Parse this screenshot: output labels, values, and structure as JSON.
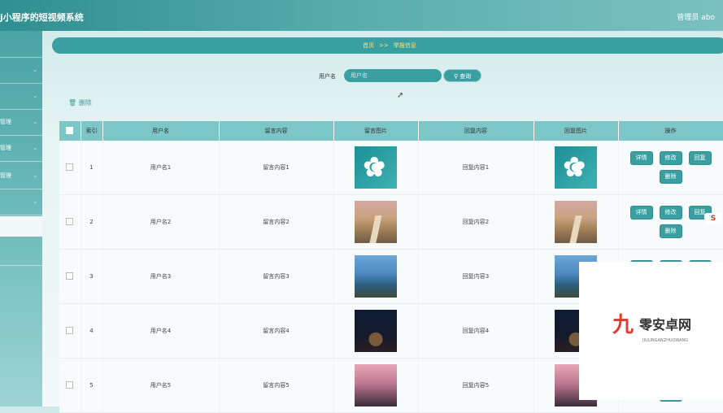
{
  "header": {
    "title": "j小程序的短视频系统",
    "admin": "管理员 abo"
  },
  "sidebar": {
    "items": [
      {
        "label": ""
      },
      {
        "label": ""
      },
      {
        "label": ""
      },
      {
        "label": "管理"
      },
      {
        "label": "管理"
      },
      {
        "label": "管理"
      },
      {
        "label": ""
      },
      {
        "label": ""
      },
      {
        "label": ""
      }
    ]
  },
  "breadcrumb": {
    "home": "首页",
    "sep": ">>",
    "current": "举报信息"
  },
  "search": {
    "label": "用户名",
    "placeholder": "用户名",
    "button": "查询"
  },
  "actions": {
    "delete_all": "删除"
  },
  "table": {
    "columns": [
      "",
      "索引",
      "用户名",
      "留言内容",
      "留言图片",
      "回复内容",
      "回复图片",
      "操作"
    ],
    "rows": [
      {
        "index": "1",
        "username": "用户名1",
        "message": "留言内容1",
        "reply": "回复内容1",
        "image": "flower-image"
      },
      {
        "index": "2",
        "username": "用户名2",
        "message": "留言内容2",
        "reply": "回复内容2",
        "image": "path-image"
      },
      {
        "index": "3",
        "username": "用户名3",
        "message": "留言内容3",
        "reply": "回复内容3",
        "image": "lake-image"
      },
      {
        "index": "4",
        "username": "用户名4",
        "message": "留言内容4",
        "reply": "回复内容4",
        "image": "night-image"
      },
      {
        "index": "5",
        "username": "用户名5",
        "message": "留言内容5",
        "reply": "回复内容5",
        "image": "girl-image"
      }
    ],
    "ops": {
      "detail": "详情",
      "edit": "修改",
      "reply": "回复",
      "delete": "删除"
    }
  },
  "watermark": {
    "logo": "九",
    "text": "零安卓网",
    "sub": "JIULINGANZHUOWANG"
  },
  "sogou_badge": "S"
}
